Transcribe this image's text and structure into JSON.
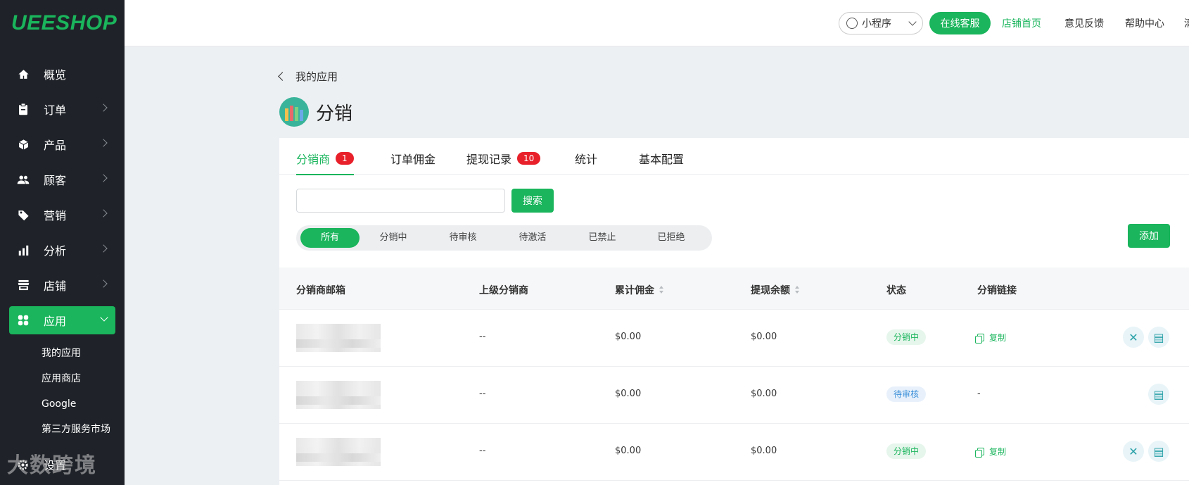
{
  "sidebar": {
    "logo": "UEESHOP",
    "items": [
      {
        "label": "概览",
        "icon": "home-icon"
      },
      {
        "label": "订单",
        "icon": "clipboard-icon"
      },
      {
        "label": "产品",
        "icon": "box-icon"
      },
      {
        "label": "顾客",
        "icon": "users-icon"
      },
      {
        "label": "营销",
        "icon": "tag-icon"
      },
      {
        "label": "分析",
        "icon": "bar-chart-icon"
      },
      {
        "label": "店铺",
        "icon": "store-icon"
      },
      {
        "label": "应用",
        "icon": "apps-icon"
      }
    ],
    "sub_items": [
      "我的应用",
      "应用商店",
      "Google",
      "第三方服务市场"
    ],
    "settings_label": "设置"
  },
  "topbar": {
    "mini_program": "小程序",
    "online_service": "在线客服",
    "links": [
      "店铺首页",
      "意见反馈",
      "帮助中心",
      "清"
    ]
  },
  "breadcrumb": "我的应用",
  "page_title": "分销",
  "tabs": [
    {
      "label": "分销商",
      "badge": "1"
    },
    {
      "label": "订单佣金"
    },
    {
      "label": "提现记录",
      "badge": "10"
    },
    {
      "label": "统计"
    },
    {
      "label": "基本配置"
    }
  ],
  "search": {
    "button": "搜索",
    "value": ""
  },
  "filters": [
    "所有",
    "分销中",
    "待审核",
    "待激活",
    "已禁止",
    "已拒绝"
  ],
  "add_button": "添加",
  "table": {
    "headers": [
      "分销商邮箱",
      "上级分销商",
      "累计佣金",
      "提现余额",
      "状态",
      "分销链接"
    ],
    "rows": [
      {
        "parent": "--",
        "commission": "$0.00",
        "balance": "$0.00",
        "status": "分销中",
        "link": "复制"
      },
      {
        "parent": "--",
        "commission": "$0.00",
        "balance": "$0.00",
        "status": "待审核",
        "link": "-"
      },
      {
        "parent": "--",
        "commission": "$0.00",
        "balance": "$0.00",
        "status": "分销中",
        "link": "复制"
      }
    ]
  },
  "watermark": "大数跨境",
  "colors": {
    "accent": "#1ab55c",
    "sidebar": "#1f2329",
    "badge": "#e8202a"
  }
}
